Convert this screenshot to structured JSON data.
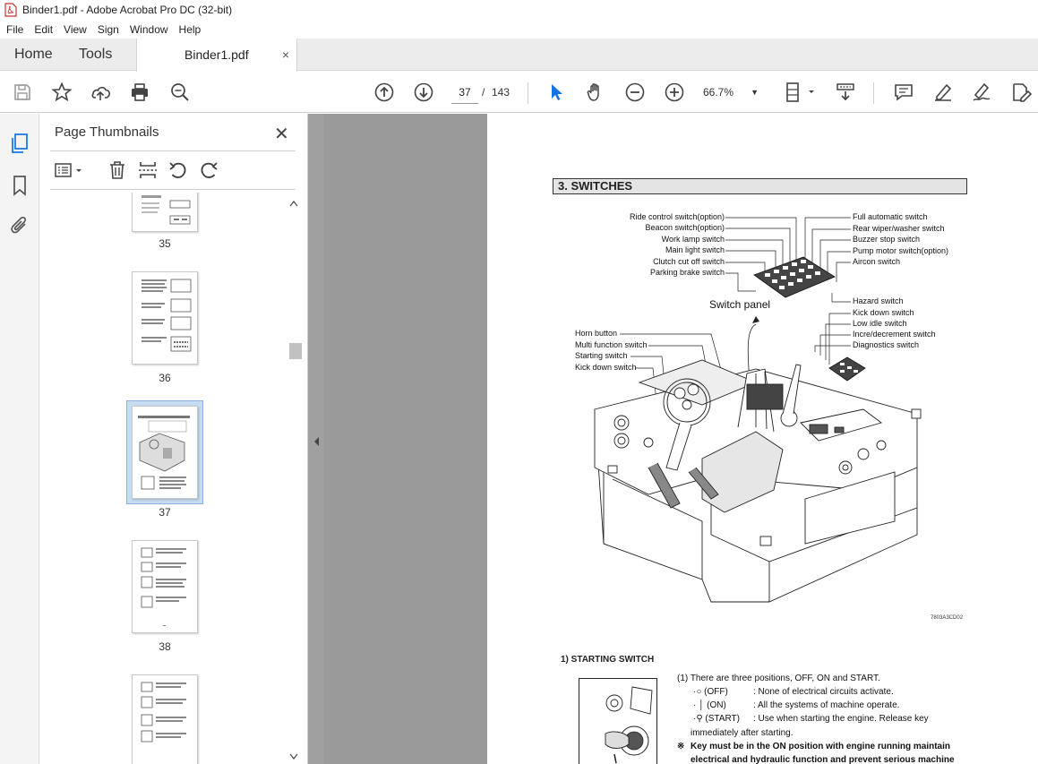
{
  "window": {
    "title": "Binder1.pdf - Adobe Acrobat Pro DC (32-bit)"
  },
  "menu": [
    "File",
    "Edit",
    "View",
    "Sign",
    "Window",
    "Help"
  ],
  "tabs": {
    "home": "Home",
    "tools": "Tools",
    "document": "Binder1.pdf",
    "close": "×"
  },
  "toolbar": {
    "current_page": "37",
    "separator": "/",
    "total_pages": "143",
    "zoom": "66.7%"
  },
  "thumbnails": {
    "title": "Page Thumbnails",
    "close": "✕",
    "pages": [
      "35",
      "36",
      "37",
      "38"
    ],
    "selected": "37"
  },
  "page": {
    "section_title": "3. SWITCHES",
    "labels_left_top": [
      "Ride control switch(option)",
      "Beacon switch(option)",
      "Work lamp switch",
      "Main light switch",
      "Clutch cut off switch",
      "Parking brake switch"
    ],
    "labels_right_top": [
      "Full automatic switch",
      "Rear wiper/washer switch",
      "Buzzer stop switch",
      "Pump motor switch(option)",
      "Aircon switch"
    ],
    "labels_right_mid": [
      "Hazard switch",
      "Kick down switch",
      "Low idle switch",
      "Incre/decrement switch",
      "Diagnostics switch"
    ],
    "labels_left_mid": [
      "Horn button",
      "Multi function switch",
      "Starting switch",
      "Kick down switch"
    ],
    "switch_panel_label": "Switch panel",
    "figure_code": "7803A3CD02",
    "subsection_title": "1)  STARTING SWITCH",
    "para1": "(1)  There are three positions, OFF, ON and START.",
    "off_label": "·○ (OFF)",
    "off_desc": ": None of electrical circuits activate.",
    "on_label": "· │ (ON)",
    "on_desc": ": All the systems of machine operate.",
    "start_label": "·⚲ (START)",
    "start_desc": ": Use when starting the engine.   Release key",
    "start_desc2": "immediately after starting.",
    "warn_mark": "※",
    "warn1": "Key must be in the ON position with engine running maintain",
    "warn2": "electrical and hydraulic function and prevent serious machine"
  },
  "colors": {
    "accent": "#1473e6",
    "doc_bg": "#a0a0a0",
    "thumb_selected": "#c6dcf2"
  }
}
